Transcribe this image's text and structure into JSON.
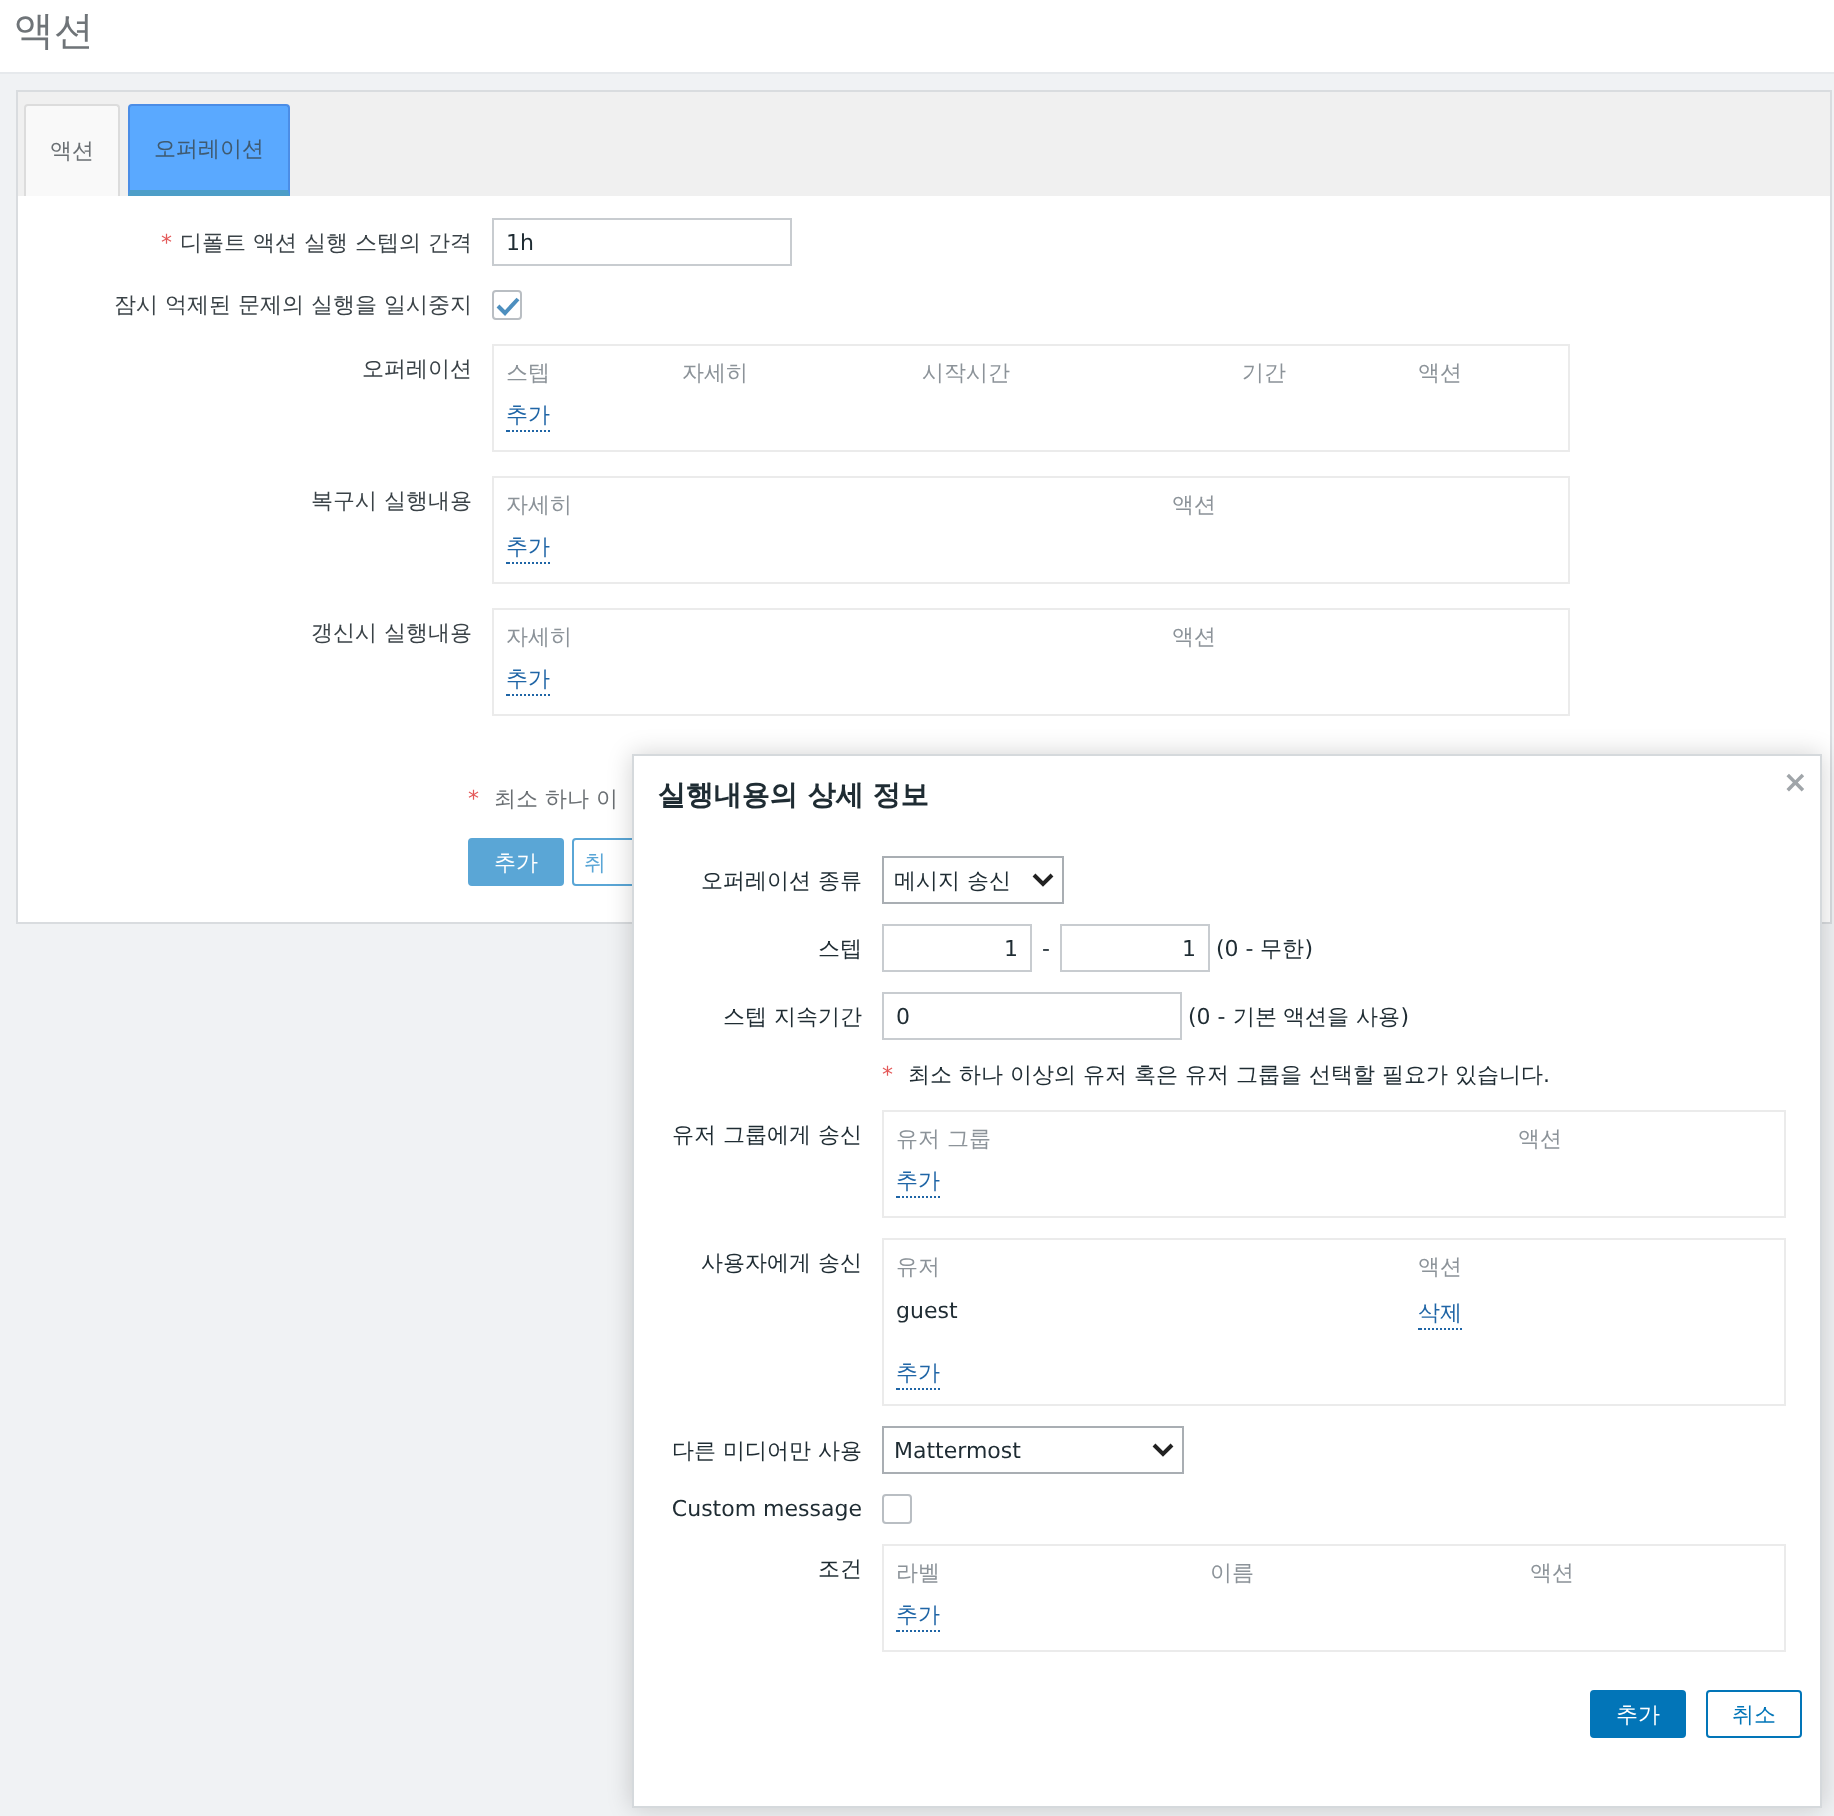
{
  "page_title": "액션",
  "tabs": [
    {
      "label": "액션",
      "selected": false
    },
    {
      "label": "오퍼레이션",
      "selected": true
    }
  ],
  "form": {
    "fields": [
      {
        "kind": "text",
        "label": "디폴트 액션 실행 스텝의 간격",
        "required_mark": "*",
        "value": "1h"
      },
      {
        "kind": "checkbox",
        "label": "잠시 억제된 문제의 실행을 일시중지",
        "checked": true
      },
      {
        "kind": "table",
        "label": "오퍼레이션",
        "columns": [
          "스텝",
          "자세히",
          "시작시간",
          "기간",
          "액션"
        ],
        "add_link": "추가"
      },
      {
        "kind": "table",
        "label": "복구시 실행내용",
        "columns": [
          "자세히",
          "액션"
        ],
        "add_link": "추가"
      },
      {
        "kind": "table",
        "label": "갱신시 실행내용",
        "columns": [
          "자세히",
          "액션"
        ],
        "add_link": "추가"
      }
    ],
    "note": {
      "mark": "*",
      "text": "최소 하나 이"
    },
    "buttons": [
      {
        "label": "추가",
        "primary": true
      },
      {
        "label": "취",
        "primary": false
      }
    ]
  },
  "dialog": {
    "title": "실행내용의 상세 정보",
    "close": "×",
    "fields": [
      {
        "kind": "select",
        "label": "오퍼레이션 종류",
        "value": "메시지 송신"
      },
      {
        "kind": "range",
        "label": "스텝",
        "from": "1",
        "separator": "-",
        "to": "1",
        "hint": "(0 - 무한)"
      },
      {
        "kind": "text",
        "label": "스텝 지속기간",
        "value": "0",
        "hint": "(0 - 기본 액션을 사용)"
      },
      {
        "kind": "note",
        "mark": "*",
        "text": "최소 하나 이상의 유저 혹은 유저 그룹을 선택할 필요가 있습니다."
      },
      {
        "kind": "table",
        "label": "유저 그룹에게 송신",
        "columns": [
          "유저 그룹",
          "액션"
        ],
        "add_link": "추가"
      },
      {
        "kind": "table",
        "label": "사용자에게 송신",
        "columns": [
          "유저",
          "액션"
        ],
        "rows": [
          {
            "name": "guest",
            "action": "삭제"
          }
        ],
        "add_link": "추가"
      },
      {
        "kind": "select",
        "label": "다른 미디어만 사용",
        "value": "Mattermost"
      },
      {
        "kind": "checkbox",
        "label": "Custom message",
        "checked": false
      },
      {
        "kind": "table",
        "label": "조건",
        "columns": [
          "라벨",
          "이름",
          "액션"
        ],
        "add_link": "추가"
      }
    ],
    "buttons": [
      {
        "label": "추가",
        "primary": true
      },
      {
        "label": "취소",
        "primary": false
      }
    ]
  }
}
